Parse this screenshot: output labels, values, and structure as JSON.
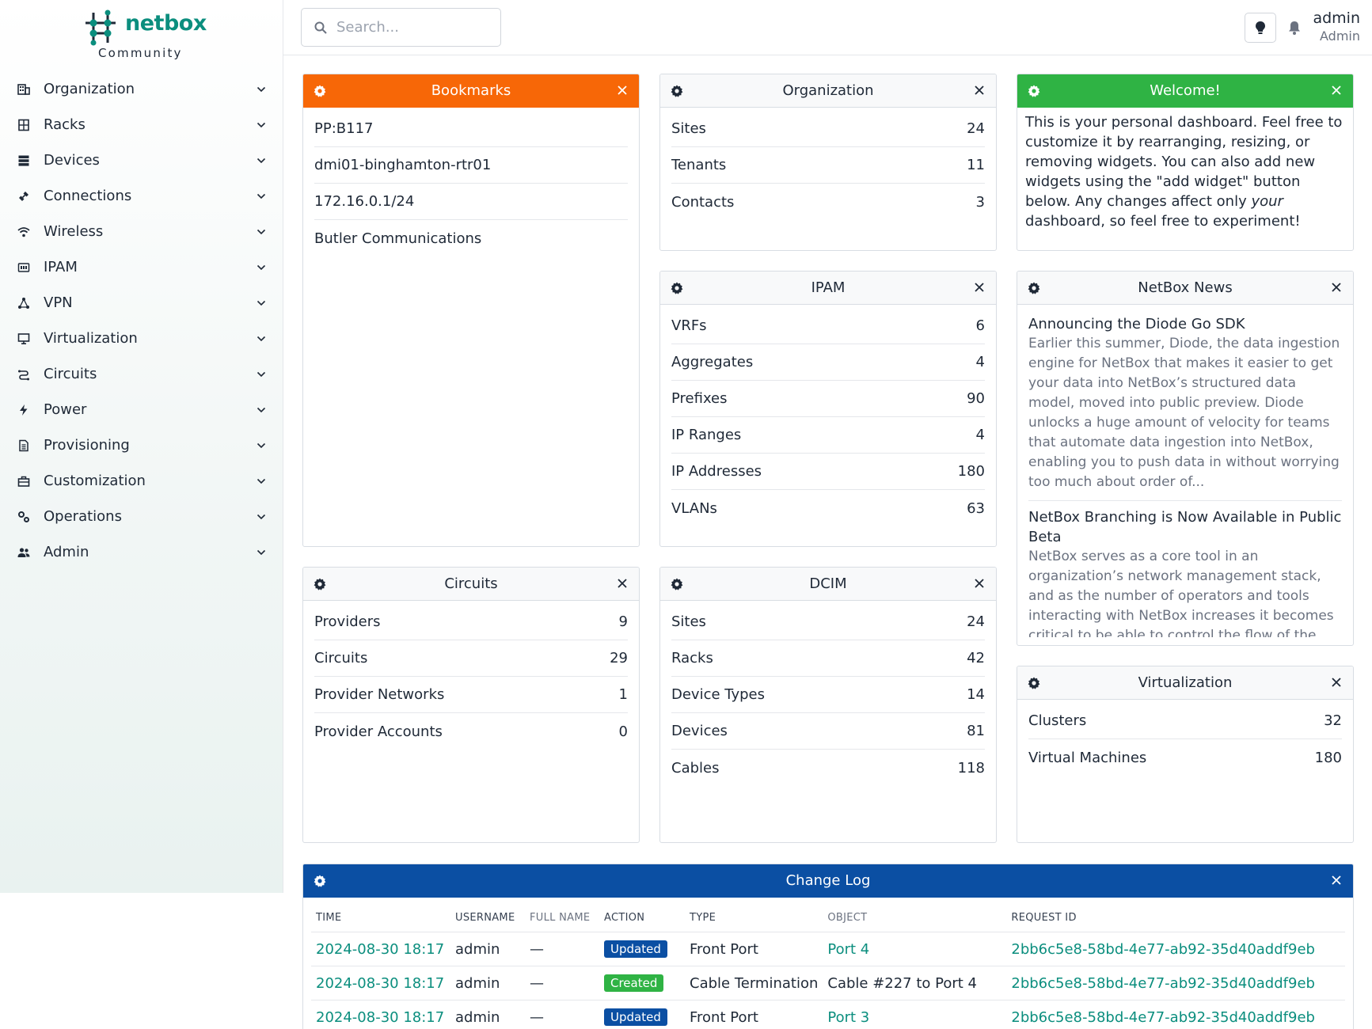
{
  "brand": {
    "name": "netbox",
    "edition": "Community"
  },
  "nav": [
    {
      "label": "Organization",
      "icon": "organization-icon"
    },
    {
      "label": "Racks",
      "icon": "rack-icon"
    },
    {
      "label": "Devices",
      "icon": "server-icon"
    },
    {
      "label": "Connections",
      "icon": "connection-icon"
    },
    {
      "label": "Wireless",
      "icon": "wifi-icon"
    },
    {
      "label": "IPAM",
      "icon": "ipam-icon"
    },
    {
      "label": "VPN",
      "icon": "vpn-icon"
    },
    {
      "label": "Virtualization",
      "icon": "monitor-icon"
    },
    {
      "label": "Circuits",
      "icon": "circuit-icon"
    },
    {
      "label": "Power",
      "icon": "power-icon"
    },
    {
      "label": "Provisioning",
      "icon": "file-icon"
    },
    {
      "label": "Customization",
      "icon": "toolbox-icon"
    },
    {
      "label": "Operations",
      "icon": "cogs-icon"
    },
    {
      "label": "Admin",
      "icon": "users-icon"
    }
  ],
  "search": {
    "placeholder": "Search..."
  },
  "user": {
    "name": "admin",
    "role": "Admin"
  },
  "widgets": {
    "bookmarks": {
      "title": "Bookmarks",
      "items": [
        "PP:B117",
        "dmi01-binghamton-rtr01",
        "172.16.0.1/24",
        "Butler Communications"
      ]
    },
    "organization": {
      "title": "Organization",
      "rows": [
        {
          "label": "Sites",
          "value": "24"
        },
        {
          "label": "Tenants",
          "value": "11"
        },
        {
          "label": "Contacts",
          "value": "3"
        }
      ]
    },
    "welcome": {
      "title": "Welcome!",
      "text_pre": "This is your personal dashboard. Feel free to customize it by rearranging, resizing, or removing widgets. You can also add new widgets using the \"add widget\" button below. Any changes affect only ",
      "text_em": "your",
      "text_post": " dashboard, so feel free to experiment!"
    },
    "ipam": {
      "title": "IPAM",
      "rows": [
        {
          "label": "VRFs",
          "value": "6"
        },
        {
          "label": "Aggregates",
          "value": "4"
        },
        {
          "label": "Prefixes",
          "value": "90"
        },
        {
          "label": "IP Ranges",
          "value": "4"
        },
        {
          "label": "IP Addresses",
          "value": "180"
        },
        {
          "label": "VLANs",
          "value": "63"
        }
      ]
    },
    "news": {
      "title": "NetBox News",
      "items": [
        {
          "title": "Announcing the Diode Go SDK",
          "desc": "Earlier this summer, Diode, the data ingestion engine for NetBox that makes it easier to get your data into NetBox’s structured data model, moved into public preview. Diode unlocks a huge amount of velocity for teams that automate data ingestion into NetBox, enabling you to push data in without worrying too much about order of..."
        },
        {
          "title": "NetBox Branching is Now Available in Public Beta",
          "desc": "NetBox serves as a core tool in an organization’s network management stack, and as the number of operators and tools interacting with NetBox increases it becomes critical to be able to control the flow of the data"
        }
      ]
    },
    "circuits": {
      "title": "Circuits",
      "rows": [
        {
          "label": "Providers",
          "value": "9"
        },
        {
          "label": "Circuits",
          "value": "29"
        },
        {
          "label": "Provider Networks",
          "value": "1"
        },
        {
          "label": "Provider Accounts",
          "value": "0"
        }
      ]
    },
    "dcim": {
      "title": "DCIM",
      "rows": [
        {
          "label": "Sites",
          "value": "24"
        },
        {
          "label": "Racks",
          "value": "42"
        },
        {
          "label": "Device Types",
          "value": "14"
        },
        {
          "label": "Devices",
          "value": "81"
        },
        {
          "label": "Cables",
          "value": "118"
        }
      ]
    },
    "virtualization": {
      "title": "Virtualization",
      "rows": [
        {
          "label": "Clusters",
          "value": "32"
        },
        {
          "label": "Virtual Machines",
          "value": "180"
        }
      ]
    },
    "changelog": {
      "title": "Change Log",
      "columns": [
        "TIME",
        "USERNAME",
        "FULL NAME",
        "ACTION",
        "TYPE",
        "OBJECT",
        "REQUEST ID"
      ],
      "rows": [
        {
          "time": "2024-08-30 18:17",
          "username": "admin",
          "full_name": "—",
          "action": "Updated",
          "type": "Front Port",
          "object": "Port 4",
          "request_id": "2bb6c5e8-58bd-4e77-ab92-35d40addf9eb"
        },
        {
          "time": "2024-08-30 18:17",
          "username": "admin",
          "full_name": "—",
          "action": "Created",
          "type": "Cable Termination",
          "object": "Cable #227 to Port 4",
          "request_id": "2bb6c5e8-58bd-4e77-ab92-35d40addf9eb"
        },
        {
          "time": "2024-08-30 18:17",
          "username": "admin",
          "full_name": "—",
          "action": "Updated",
          "type": "Front Port",
          "object": "Port 3",
          "request_id": "2bb6c5e8-58bd-4e77-ab92-35d40addf9eb"
        }
      ]
    }
  },
  "colors": {
    "accent": "#0b8e7e",
    "bookmarks_header": "#f76707",
    "welcome_header": "#2fb344",
    "changelog_header": "#0b4fa3"
  }
}
